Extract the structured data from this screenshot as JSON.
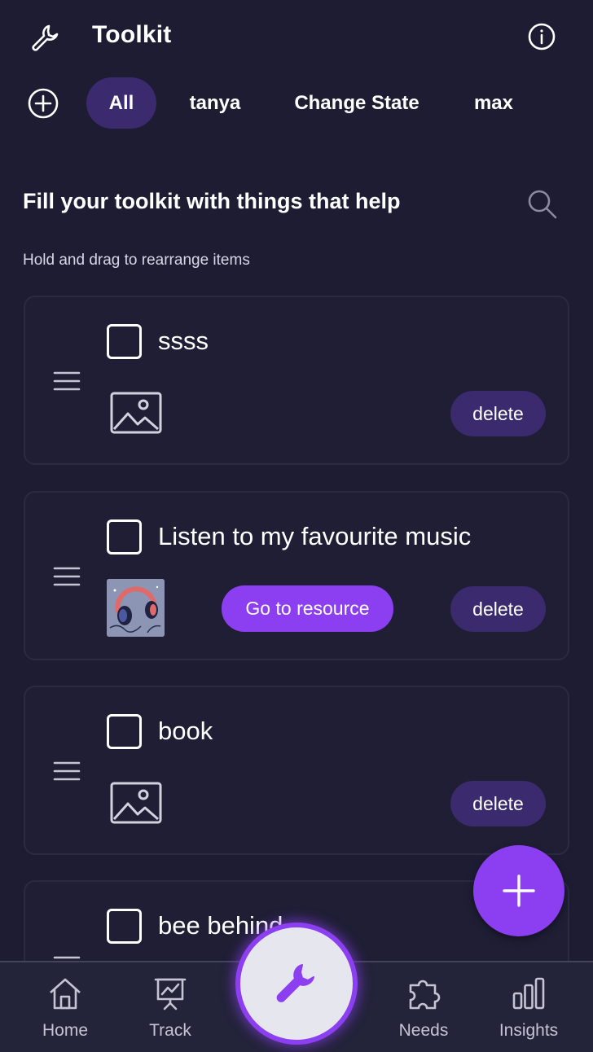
{
  "header": {
    "title": "Toolkit"
  },
  "tabs": [
    {
      "label": "All",
      "active": true
    },
    {
      "label": "tanya",
      "active": false
    },
    {
      "label": "Change State",
      "active": false
    },
    {
      "label": "max",
      "active": false
    }
  ],
  "intro": {
    "title": "Fill your toolkit with things that help",
    "hint": "Hold and drag to rearrange items"
  },
  "items": [
    {
      "title": "ssss",
      "media": "image-placeholder-icon",
      "resource_button": null,
      "delete_label": "delete"
    },
    {
      "title": "Listen to my favourite music",
      "media": "headphones-thumbnail",
      "resource_button": "Go to resource",
      "delete_label": "delete"
    },
    {
      "title": "book",
      "media": "image-placeholder-icon",
      "resource_button": null,
      "delete_label": "delete"
    },
    {
      "title": "bee behind"
    }
  ],
  "bottom_nav": {
    "home": "Home",
    "track": "Track",
    "needs": "Needs",
    "insights": "Insights"
  },
  "colors": {
    "background": "#1d1c33",
    "accent": "#8c3ff0",
    "pill": "#3c2a6e"
  }
}
